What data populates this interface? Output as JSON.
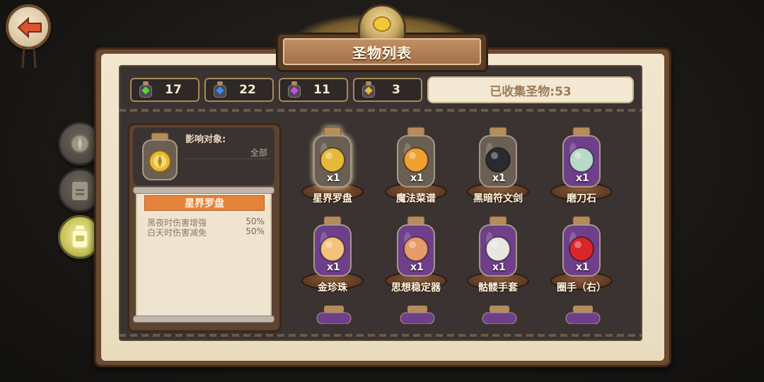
{
  "title": "圣物列表",
  "back_button": {
    "icon": "arrow-left-icon"
  },
  "side_tabs": [
    {
      "icon": "compass-icon",
      "active": false
    },
    {
      "icon": "lock-icon",
      "active": false
    },
    {
      "icon": "jar-icon",
      "active": true
    }
  ],
  "counters": [
    {
      "gem": "green-gem-icon",
      "color": "#5fd13a",
      "value": "17"
    },
    {
      "gem": "blue-gem-icon",
      "color": "#3a8bf0",
      "value": "22"
    },
    {
      "gem": "purple-gem-icon",
      "color": "#d14ae6",
      "value": "11"
    },
    {
      "gem": "gold-gem-icon",
      "color": "#f0b82a",
      "value": "3"
    }
  ],
  "collected_label": "已收集圣物:53",
  "detail": {
    "effect_title": "影响对象:",
    "effect_target": "全部",
    "item_name": "星界罗盘",
    "stats": [
      {
        "label": "黑夜时伤害增强",
        "value": "50%"
      },
      {
        "label": "白天时伤害减免",
        "value": "50%"
      }
    ]
  },
  "relics": [
    {
      "name": "星界罗盘",
      "qty": "x1",
      "icon": "compass-icon",
      "fill": "#6a5f52",
      "accent": "#e7b93a",
      "selected": true
    },
    {
      "name": "魔法菜谱",
      "qty": "x1",
      "icon": "book-icon",
      "fill": "#6a5f52",
      "accent": "#f0a030",
      "selected": false
    },
    {
      "name": "黑暗符文剑",
      "qty": "x1",
      "icon": "sword-icon",
      "fill": "#6a5f52",
      "accent": "#2a2a30",
      "selected": false
    },
    {
      "name": "磨刀石",
      "qty": "x1",
      "icon": "whetstone-icon",
      "fill": "#6f3f8a",
      "accent": "#b8d8c8",
      "selected": false
    },
    {
      "name": "金珍珠",
      "qty": "x1",
      "icon": "pearl-icon",
      "fill": "#6f3f8a",
      "accent": "#f4c27a",
      "selected": false
    },
    {
      "name": "思想稳定器",
      "qty": "x1",
      "icon": "stabilizer-icon",
      "fill": "#6f3f8a",
      "accent": "#e79a6a",
      "selected": false
    },
    {
      "name": "骷髅手套",
      "qty": "x1",
      "icon": "skeleton-glove-icon",
      "fill": "#6f3f8a",
      "accent": "#e8e6e0",
      "selected": false
    },
    {
      "name": "圈手（右）",
      "qty": "x1",
      "icon": "boxing-glove-icon",
      "fill": "#6f3f8a",
      "accent": "#d8262a",
      "selected": false
    }
  ]
}
